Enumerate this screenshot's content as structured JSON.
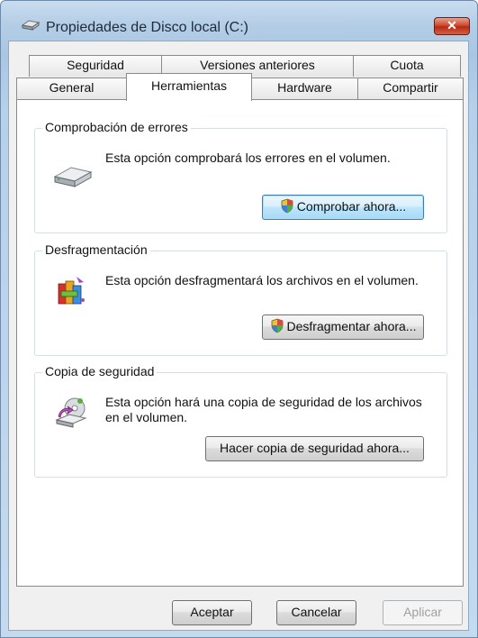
{
  "window": {
    "title": "Propiedades de Disco local (C:)",
    "close_label": "✕"
  },
  "tabs": {
    "row1": [
      "Seguridad",
      "Versiones anteriores",
      "Cuota"
    ],
    "row2": [
      "General",
      "Herramientas",
      "Hardware",
      "Compartir"
    ],
    "active": "Herramientas"
  },
  "groups": [
    {
      "title": "Comprobación de errores",
      "text": "Esta opción comprobará los errores en el volumen.",
      "button": "Comprobar ahora...",
      "icon": "hard-drive-icon"
    },
    {
      "title": "Desfragmentación",
      "text": "Esta opción desfragmentará los archivos en el volumen.",
      "button": "Desfragmentar ahora...",
      "icon": "defrag-icon"
    },
    {
      "title": "Copia de seguridad",
      "text": "Esta opción hará una copia de seguridad de los archivos en el volumen.",
      "button": "Hacer copia de seguridad ahora...",
      "icon": "backup-icon"
    }
  ],
  "footer": {
    "ok": "Aceptar",
    "cancel": "Cancelar",
    "apply": "Aplicar"
  },
  "colors": {
    "title_bar": "#b3cde6",
    "close_button": "#cf4a32",
    "focus_button": "#bee6fd",
    "panel": "#ffffff"
  }
}
